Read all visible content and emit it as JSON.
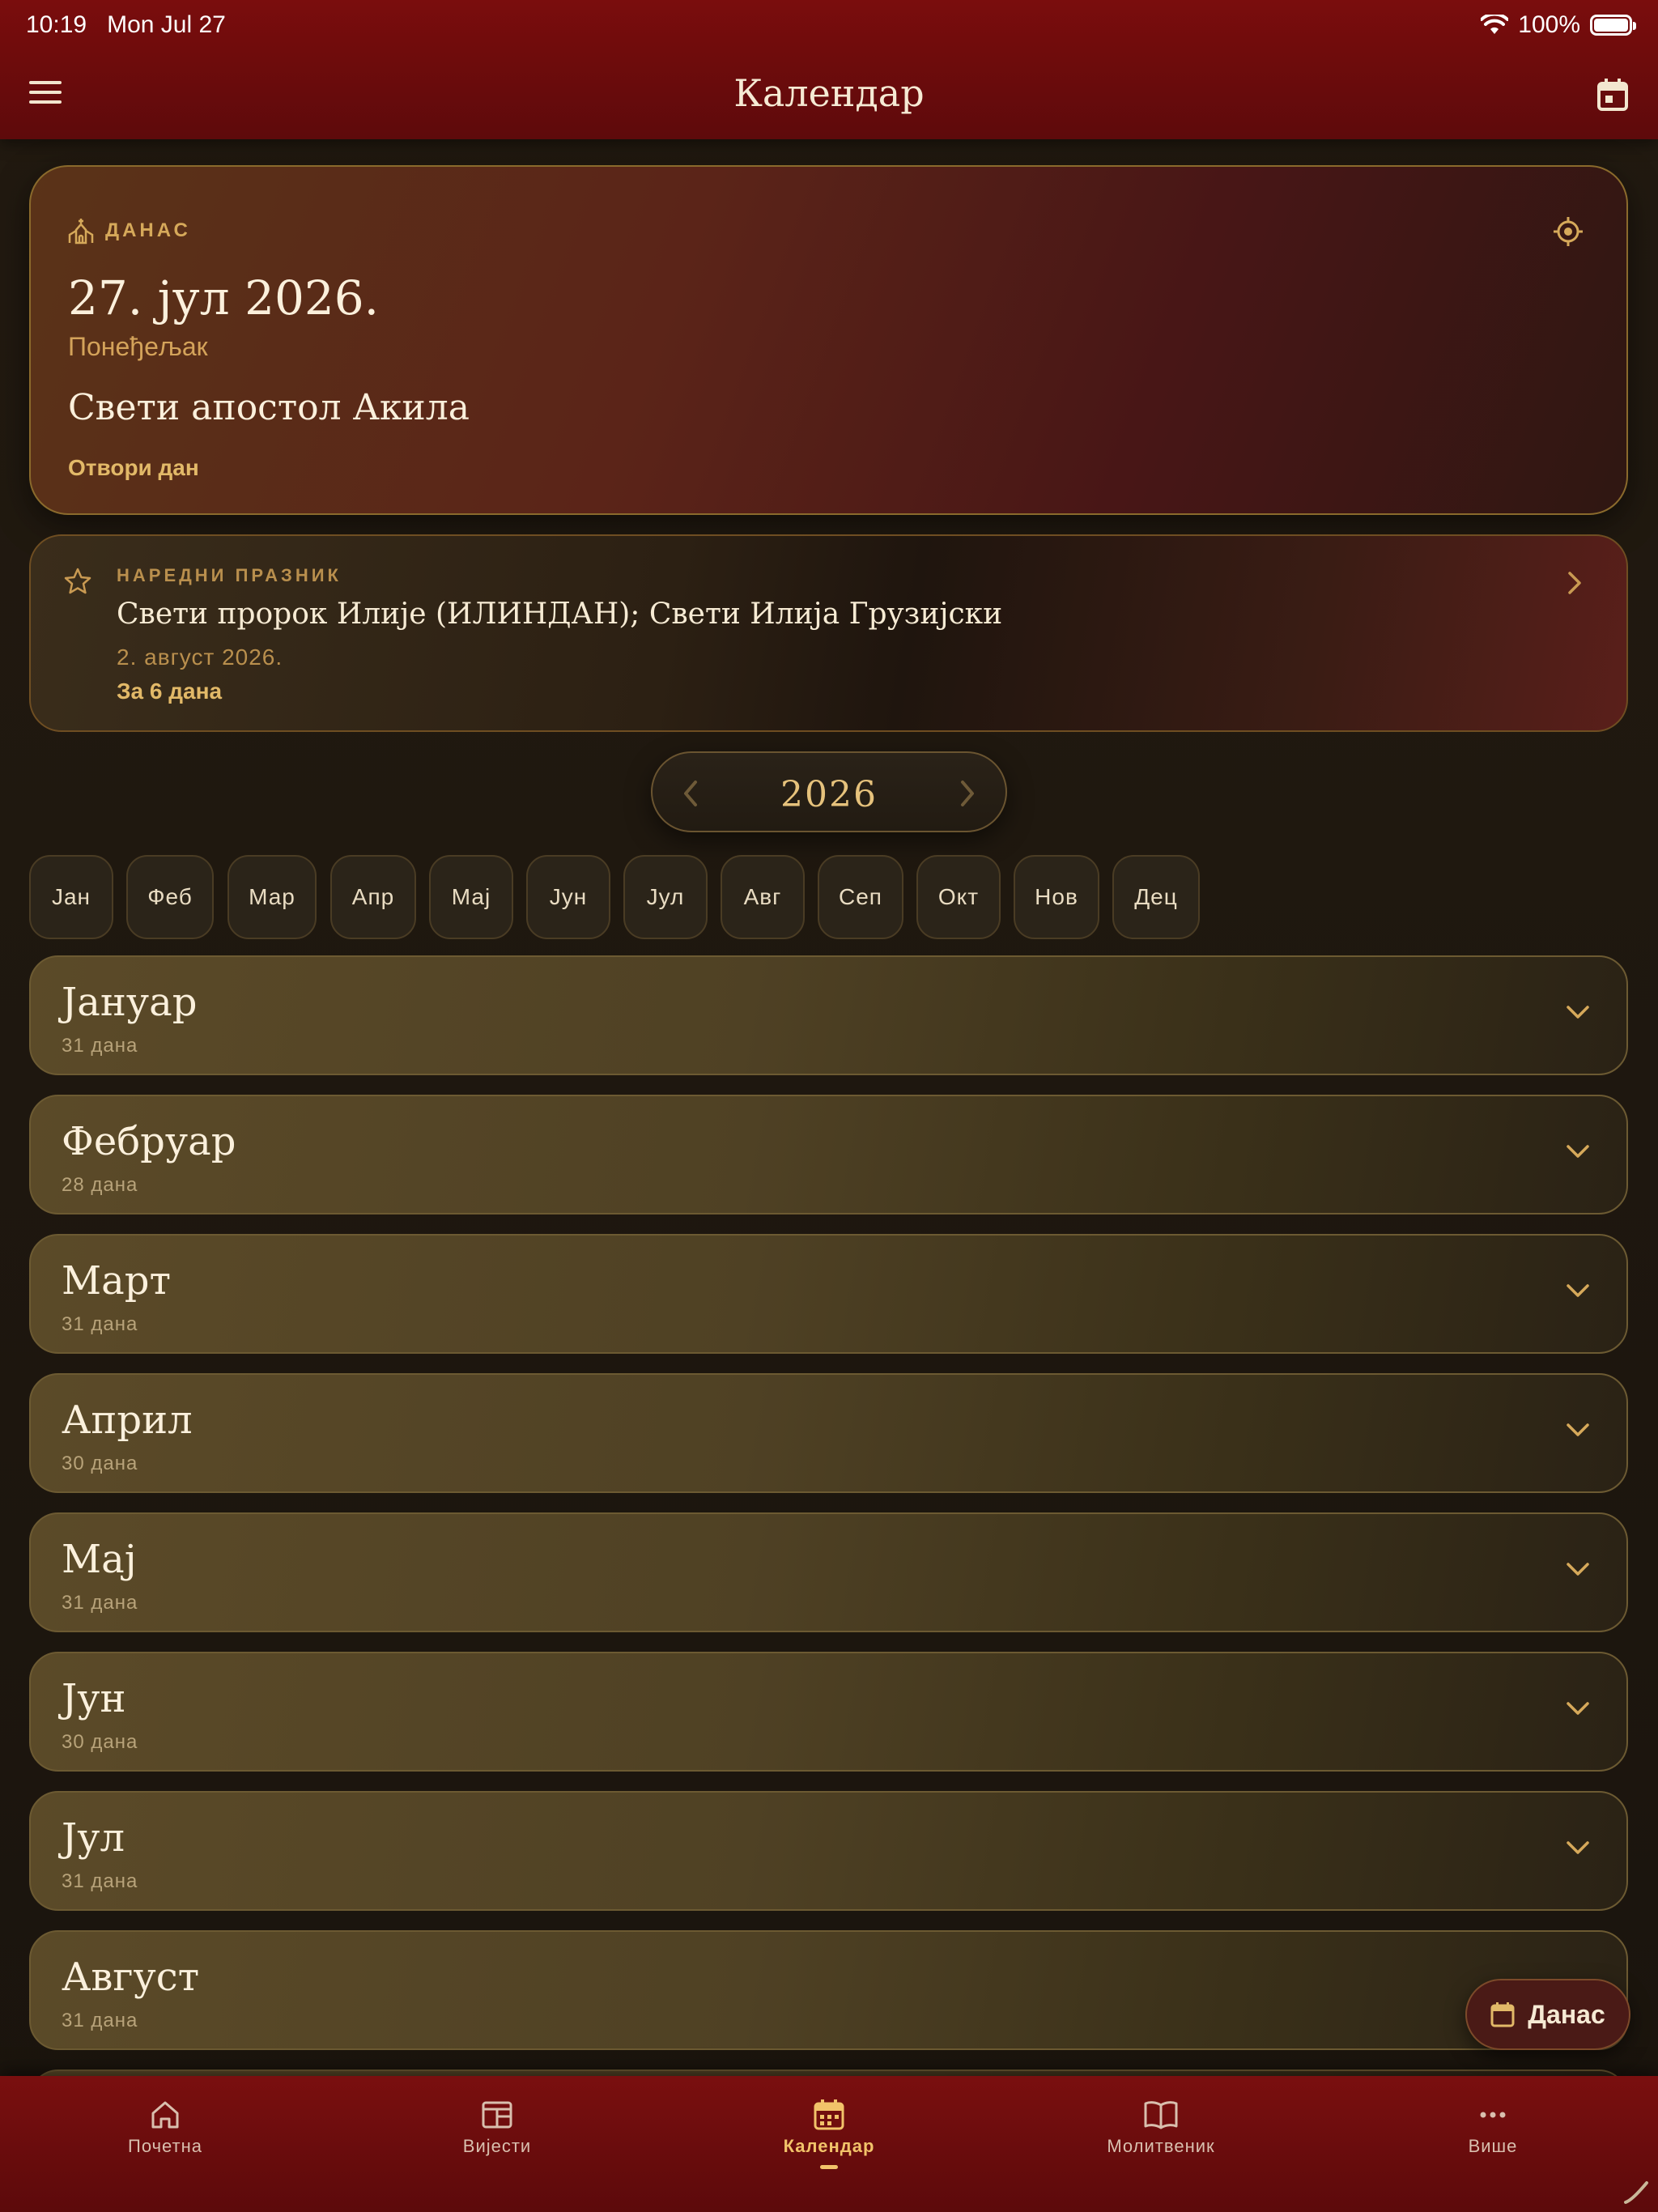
{
  "status_bar": {
    "time": "10:19",
    "date": "Mon Jul 27",
    "battery": "100%"
  },
  "header": {
    "title": "Календар"
  },
  "today": {
    "label": "ДАНАС",
    "date": "27. јул 2026.",
    "weekday": "Понеђељак",
    "saint": "Свети апостол Акила",
    "open_day": "Отвори дан"
  },
  "next_holiday": {
    "label": "НАРЕДНИ ПРАЗНИК",
    "name": "Свети пророк Илије (ИЛИНДАН); Свети Илија Грузијски",
    "date": "2. август 2026.",
    "countdown": "За 6 дана"
  },
  "year_selector": {
    "year": "2026"
  },
  "month_chips": [
    "Јан",
    "Феб",
    "Мар",
    "Апр",
    "Мај",
    "Јун",
    "Јул",
    "Авг",
    "Сеп",
    "Окт",
    "Нов",
    "Дец"
  ],
  "months": [
    {
      "name": "Јануар",
      "days": "31 дана"
    },
    {
      "name": "Фебруар",
      "days": "28 дана"
    },
    {
      "name": "Март",
      "days": "31 дана"
    },
    {
      "name": "Април",
      "days": "30 дана"
    },
    {
      "name": "Мај",
      "days": "31 дана"
    },
    {
      "name": "Јун",
      "days": "30 дана"
    },
    {
      "name": "Јул",
      "days": "31 дана"
    },
    {
      "name": "Август",
      "days": "31 дана"
    }
  ],
  "fab": {
    "label": "Данас"
  },
  "bottom_nav": [
    {
      "label": "Почетна",
      "icon": "home-icon",
      "active": false
    },
    {
      "label": "Вијести",
      "icon": "news-icon",
      "active": false
    },
    {
      "label": "Календар",
      "icon": "calendar-icon",
      "active": true
    },
    {
      "label": "Молитвеник",
      "icon": "book-icon",
      "active": false
    },
    {
      "label": "Више",
      "icon": "more-icon",
      "active": false
    }
  ],
  "colors": {
    "accent": "#e2b968",
    "header": "#7a0d0d",
    "background": "#1e170f"
  }
}
